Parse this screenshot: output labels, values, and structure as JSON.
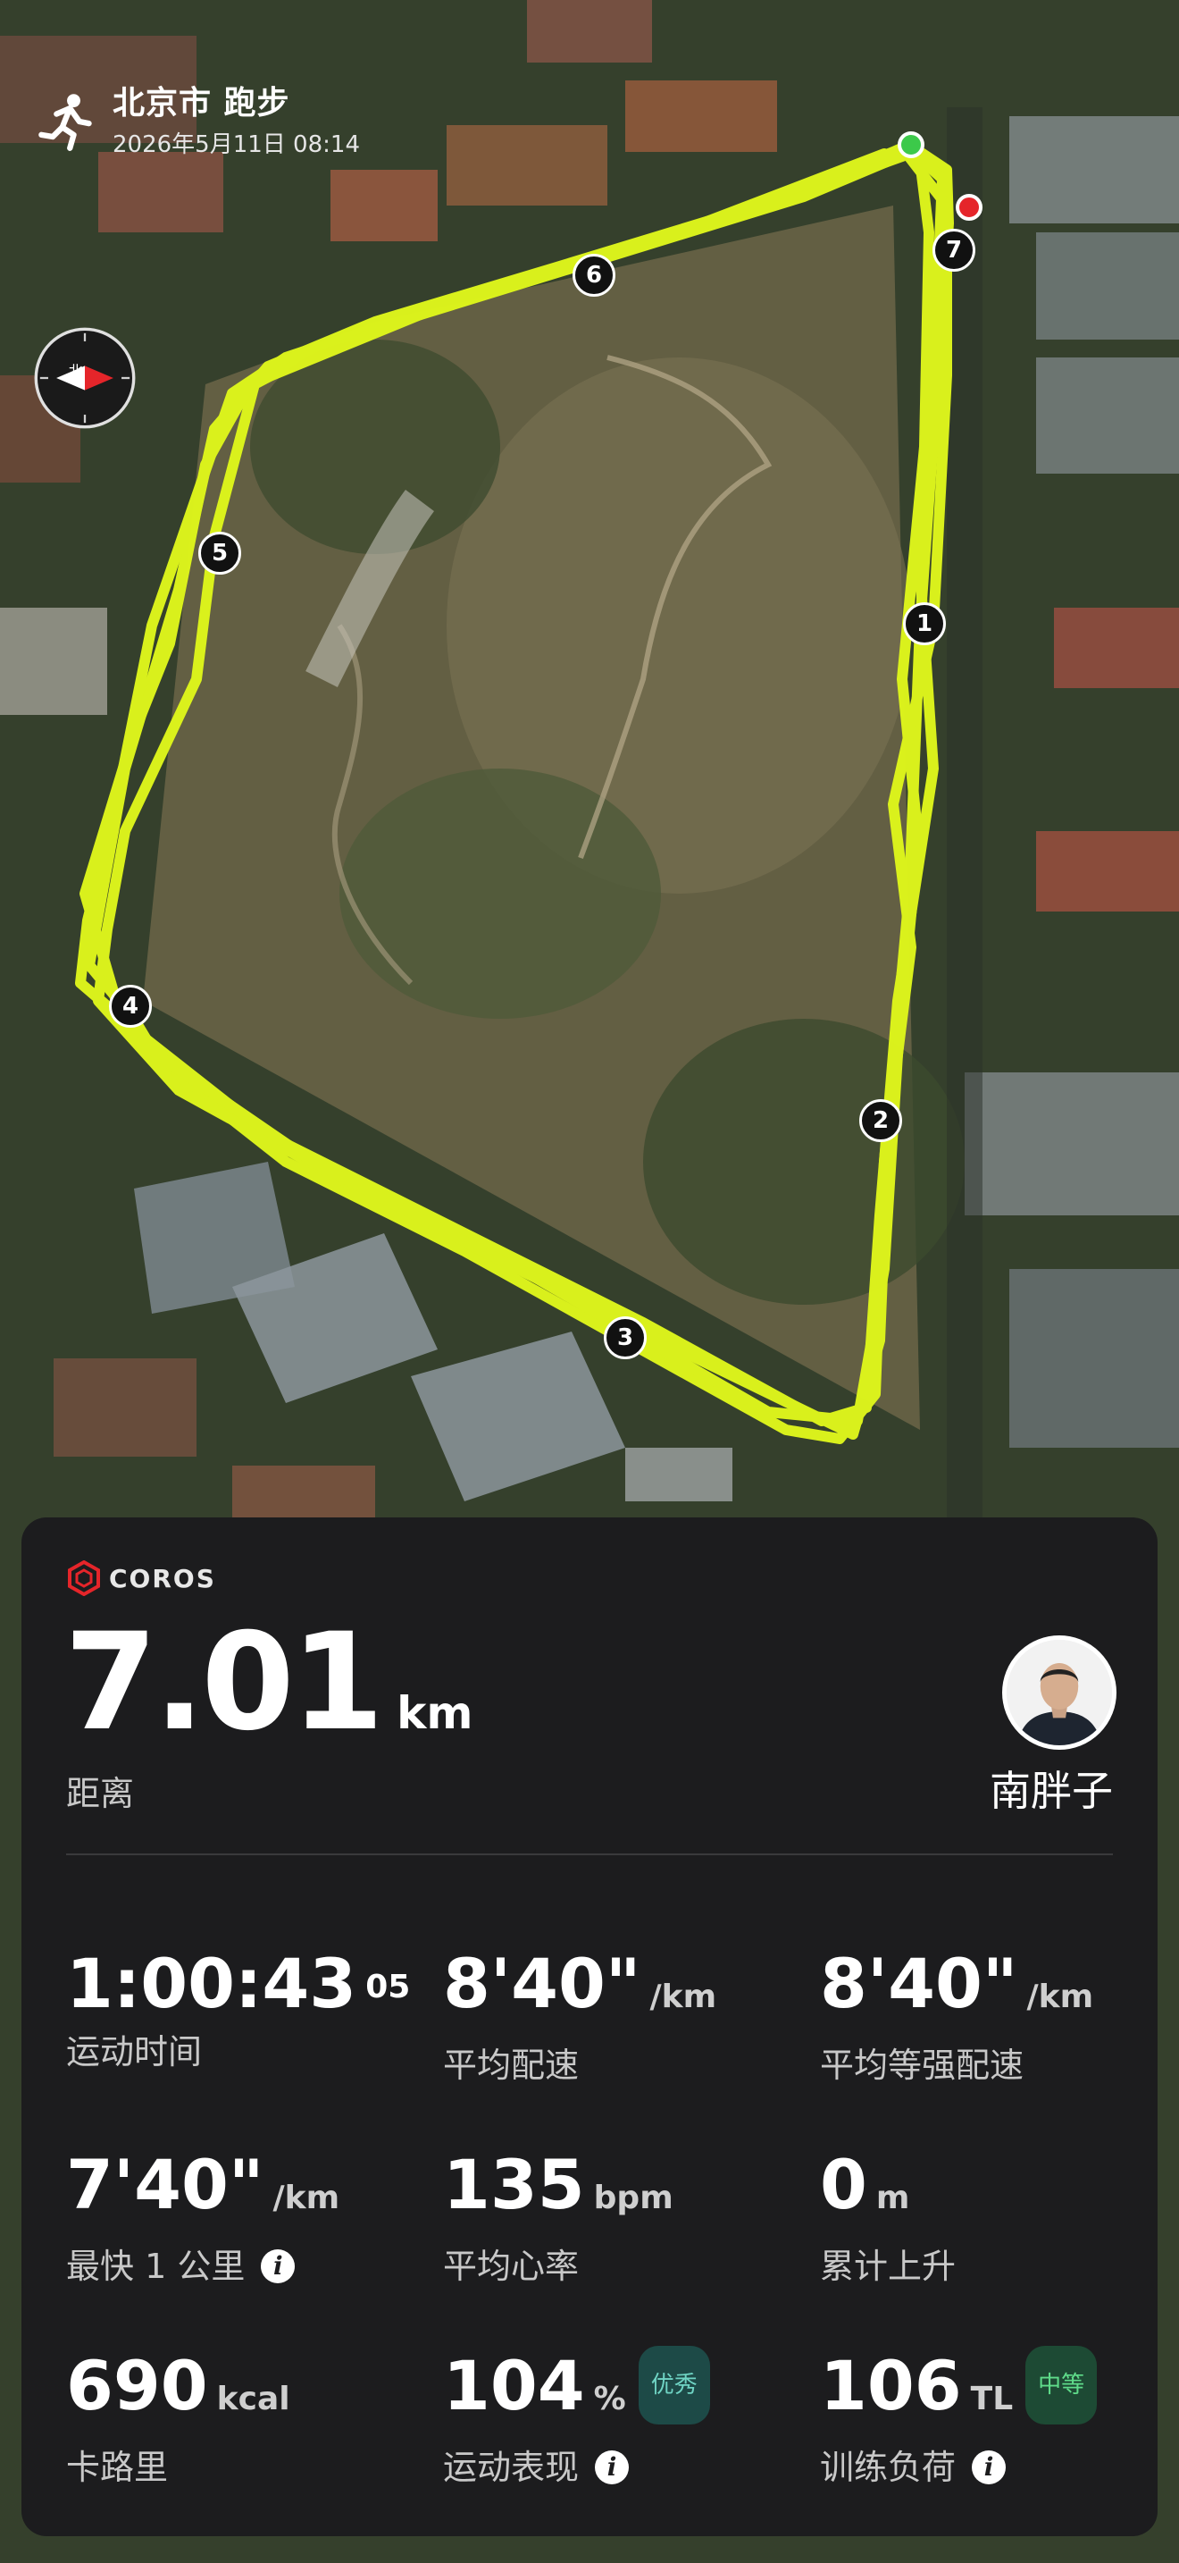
{
  "header": {
    "title": "北京市 跑步",
    "datetime": "2026年5月11日 08:14"
  },
  "map": {
    "route_color": "#DDF41C",
    "start_color": "#3CC94A",
    "end_color": "#E5252A",
    "km_markers": [
      "1",
      "2",
      "3",
      "4",
      "5",
      "6",
      "7"
    ]
  },
  "card": {
    "brand": "COROS",
    "distance": {
      "value": "7.01",
      "unit": "km",
      "label": "距离"
    },
    "user": {
      "name": "南胖子"
    },
    "stats": {
      "duration": {
        "value": "1:00:43",
        "sup": "05",
        "label": "运动时间"
      },
      "avg_pace": {
        "value": "8'40\"",
        "unit": "/km",
        "label": "平均配速"
      },
      "avg_grade_pace": {
        "value": "8'40\"",
        "unit": "/km",
        "label": "平均等强配速"
      },
      "fastest_km": {
        "value": "7'40\"",
        "unit": "/km",
        "label": "最快 1 公里"
      },
      "avg_hr": {
        "value": "135",
        "unit": "bpm",
        "label": "平均心率"
      },
      "ascent": {
        "value": "0",
        "unit": "m",
        "label": "累计上升"
      },
      "calories": {
        "value": "690",
        "unit": "kcal",
        "label": "卡路里"
      },
      "performance": {
        "value": "104",
        "unit": "%",
        "badge": "优秀",
        "label": "运动表现"
      },
      "training_load": {
        "value": "106",
        "unit": "TL",
        "badge": "中等",
        "label": "训练负荷"
      }
    }
  }
}
